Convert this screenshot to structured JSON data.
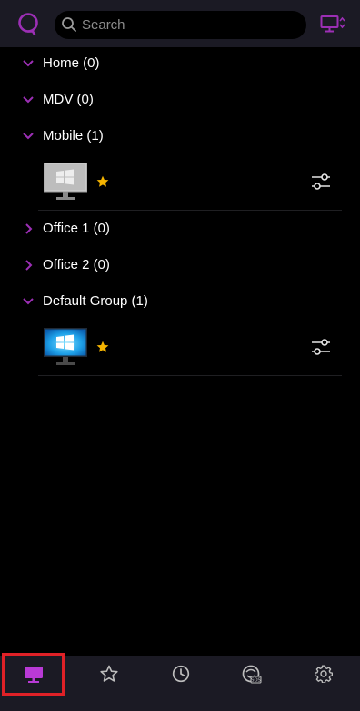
{
  "search": {
    "placeholder": "Search"
  },
  "groups": [
    {
      "label": "Home (0)",
      "expanded": true
    },
    {
      "label": "MDV (0)",
      "expanded": true
    },
    {
      "label": "Mobile (1)",
      "expanded": true,
      "devices": [
        {
          "os": "windows",
          "status": "offline",
          "favorite": true
        }
      ]
    },
    {
      "label": "Office 1 (0)",
      "expanded": false
    },
    {
      "label": "Office 2 (0)",
      "expanded": false
    },
    {
      "label": "Default Group (1)",
      "expanded": true,
      "devices": [
        {
          "os": "windows",
          "status": "online",
          "favorite": true
        }
      ]
    }
  ],
  "tabs": [
    {
      "name": "computers",
      "icon": "monitor-icon",
      "active": true
    },
    {
      "name": "favorites",
      "icon": "star-icon",
      "active": false
    },
    {
      "name": "history",
      "icon": "clock-icon",
      "active": false
    },
    {
      "name": "sos",
      "icon": "sos-icon",
      "active": false
    },
    {
      "name": "settings",
      "icon": "gear-icon",
      "active": false
    }
  ],
  "colors": {
    "accent": "#9c2fb5",
    "star": "#f5b400",
    "bar": "#1b1a24",
    "highlight": "#e02127"
  }
}
